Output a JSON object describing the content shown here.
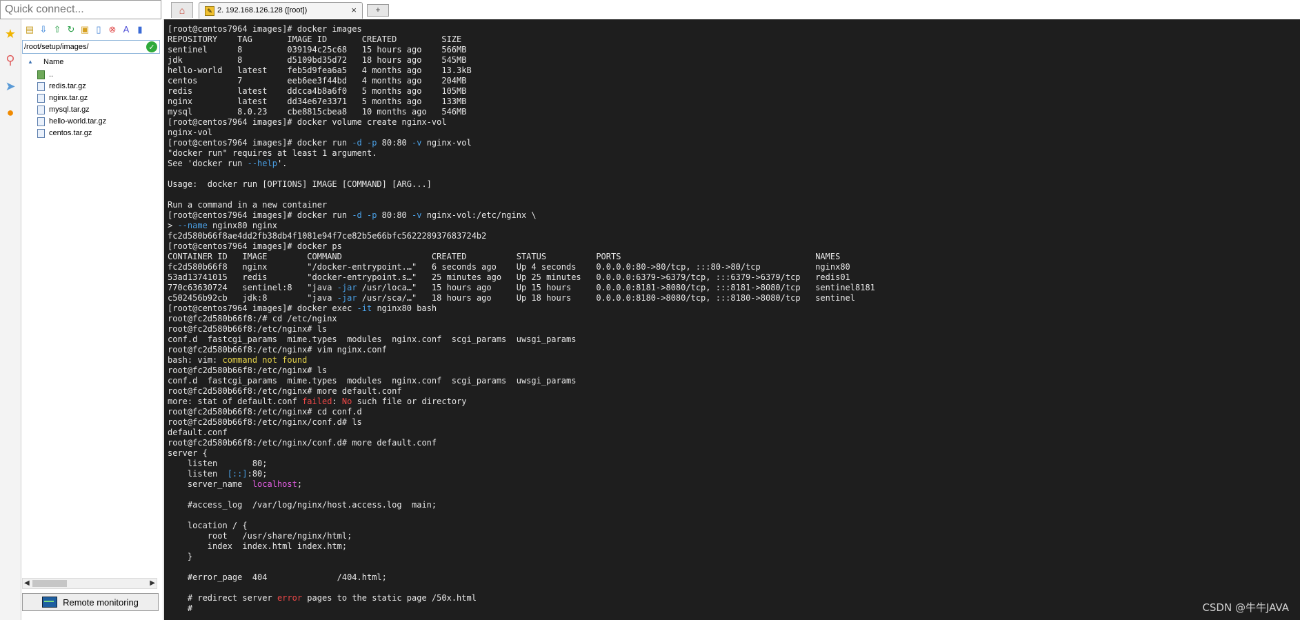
{
  "sidebar": {
    "quick_connect_placeholder": "Quick connect...",
    "rail_icons": [
      "star-icon",
      "session-icon",
      "send-icon",
      "tools-icon"
    ],
    "toolbar_icons": [
      "up-folder-icon",
      "download-icon",
      "upload-icon",
      "refresh-icon",
      "new-folder-icon",
      "new-file-icon",
      "delete-icon",
      "rename-icon",
      "properties-icon"
    ],
    "path": "/root/setup/images/",
    "tree_header": "Name",
    "files": [
      {
        "name": "..",
        "kind": "folder"
      },
      {
        "name": "redis.tar.gz",
        "kind": "file"
      },
      {
        "name": "nginx.tar.gz",
        "kind": "file"
      },
      {
        "name": "mysql.tar.gz",
        "kind": "file"
      },
      {
        "name": "hello-world.tar.gz",
        "kind": "file"
      },
      {
        "name": "centos.tar.gz",
        "kind": "file"
      }
    ],
    "remote_monitoring_label": "Remote monitoring"
  },
  "tabs": {
    "session_label": "2. 192.168.126.128 ([root])",
    "close_glyph": "×",
    "new_tab_glyph": "+"
  },
  "terminal": {
    "lines": [
      [
        [
          "[root@centos7964 images]# docker images",
          ""
        ]
      ],
      [
        [
          "REPOSITORY    TAG       IMAGE ID       CREATED         SIZE",
          ""
        ]
      ],
      [
        [
          "sentinel      8         039194c25c68   15 hours ago    566MB",
          ""
        ]
      ],
      [
        [
          "jdk           8         d5109bd35d72   18 hours ago    545MB",
          ""
        ]
      ],
      [
        [
          "hello-world   latest    feb5d9fea6a5   4 months ago    13.3kB",
          ""
        ]
      ],
      [
        [
          "centos        7         eeb6ee3f44bd   4 months ago    204MB",
          ""
        ]
      ],
      [
        [
          "redis         latest    ddcca4b8a6f0   5 months ago    105MB",
          ""
        ]
      ],
      [
        [
          "nginx         latest    dd34e67e3371   5 months ago    133MB",
          ""
        ]
      ],
      [
        [
          "mysql         8.0.23    cbe8815cbea8   10 months ago   546MB",
          ""
        ]
      ],
      [
        [
          "[root@centos7964 images]# docker volume create nginx-vol",
          ""
        ]
      ],
      [
        [
          "nginx-vol",
          ""
        ]
      ],
      [
        [
          "[root@centos7964 images]# docker run ",
          ""
        ],
        [
          "-d -p",
          "blue"
        ],
        [
          " 80:80 ",
          ""
        ],
        [
          "-v",
          "blue"
        ],
        [
          " nginx-vol",
          ""
        ]
      ],
      [
        [
          "\"docker run\" requires at least 1 argument.",
          ""
        ]
      ],
      [
        [
          "See 'docker run ",
          ""
        ],
        [
          "--help",
          "blue"
        ],
        [
          "'.",
          ""
        ]
      ],
      [
        [
          "",
          ""
        ]
      ],
      [
        [
          "Usage:  docker run [OPTIONS] IMAGE [COMMAND] [ARG...]",
          ""
        ]
      ],
      [
        [
          "",
          ""
        ]
      ],
      [
        [
          "Run a command in a new container",
          ""
        ]
      ],
      [
        [
          "[root@centos7964 images]# docker run ",
          ""
        ],
        [
          "-d -p",
          "blue"
        ],
        [
          " 80:80 ",
          ""
        ],
        [
          "-v",
          "blue"
        ],
        [
          " nginx-vol:/etc/nginx \\",
          ""
        ]
      ],
      [
        [
          "> ",
          ""
        ],
        [
          "--name",
          "blue"
        ],
        [
          " nginx80 nginx",
          ""
        ]
      ],
      [
        [
          "fc2d580b66f8ae4dd2fb38db4f1081e94f7ce82b5e66bfc562228937683724b2",
          ""
        ]
      ],
      [
        [
          "[root@centos7964 images]# docker ps",
          ""
        ]
      ],
      [
        [
          "CONTAINER ID   IMAGE        COMMAND                  CREATED          STATUS          PORTS                                       NAMES",
          ""
        ]
      ],
      [
        [
          "fc2d580b66f8   nginx        \"/docker-entrypoint.…\"   6 seconds ago    Up 4 seconds    0.0.0.0:80->80/tcp, :::80->80/tcp           nginx80",
          ""
        ]
      ],
      [
        [
          "53ad13741015   redis        \"docker-entrypoint.s…\"   25 minutes ago   Up 25 minutes   0.0.0.0:6379->6379/tcp, :::6379->6379/tcp   redis01",
          ""
        ]
      ],
      [
        [
          "770c63630724   sentinel:8   \"java ",
          ""
        ],
        [
          "-jar",
          "blue"
        ],
        [
          " /usr/loca…\"   15 hours ago     Up 15 hours     0.0.0.0:8181->8080/tcp, :::8181->8080/tcp   sentinel8181",
          ""
        ]
      ],
      [
        [
          "c502456b92cb   jdk:8        \"java ",
          ""
        ],
        [
          "-jar",
          "blue"
        ],
        [
          " /usr/sca/…\"   18 hours ago     Up 18 hours     0.0.0.0:8180->8080/tcp, :::8180->8080/tcp   sentinel",
          ""
        ]
      ],
      [
        [
          "[root@centos7964 images]# docker exec ",
          ""
        ],
        [
          "-it",
          "blue"
        ],
        [
          " nginx80 bash",
          ""
        ]
      ],
      [
        [
          "root@fc2d580b66f8:/# cd /etc/nginx",
          ""
        ]
      ],
      [
        [
          "root@fc2d580b66f8:/etc/nginx# ls",
          ""
        ]
      ],
      [
        [
          "conf.d  fastcgi_params  mime.types  modules  nginx.conf  scgi_params  uwsgi_params",
          ""
        ]
      ],
      [
        [
          "root@fc2d580b66f8:/etc/nginx# vim nginx.conf",
          ""
        ]
      ],
      [
        [
          "bash: vim: ",
          ""
        ],
        [
          "command not found",
          "yellow"
        ]
      ],
      [
        [
          "root@fc2d580b66f8:/etc/nginx# ls",
          ""
        ]
      ],
      [
        [
          "conf.d  fastcgi_params  mime.types  modules  nginx.conf  scgi_params  uwsgi_params",
          ""
        ]
      ],
      [
        [
          "root@fc2d580b66f8:/etc/nginx# more default.conf",
          ""
        ]
      ],
      [
        [
          "more: stat of default.conf ",
          ""
        ],
        [
          "failed",
          "red"
        ],
        [
          ": ",
          ""
        ],
        [
          "No",
          "red"
        ],
        [
          " such file or directory",
          ""
        ]
      ],
      [
        [
          "root@fc2d580b66f8:/etc/nginx# cd conf.d",
          ""
        ]
      ],
      [
        [
          "root@fc2d580b66f8:/etc/nginx/conf.d# ls",
          ""
        ]
      ],
      [
        [
          "default.conf",
          ""
        ]
      ],
      [
        [
          "root@fc2d580b66f8:/etc/nginx/conf.d# more default.conf",
          ""
        ]
      ],
      [
        [
          "server {",
          ""
        ]
      ],
      [
        [
          "    listen       80;",
          ""
        ]
      ],
      [
        [
          "    listen  ",
          ""
        ],
        [
          "[::]",
          "blue"
        ],
        [
          ":80;",
          ""
        ]
      ],
      [
        [
          "    server_name  ",
          ""
        ],
        [
          "localhost",
          "mag"
        ],
        [
          ";",
          ""
        ]
      ],
      [
        [
          "",
          ""
        ]
      ],
      [
        [
          "    #access_log  /var/log/nginx/host.access.log  main;",
          ""
        ]
      ],
      [
        [
          "",
          ""
        ]
      ],
      [
        [
          "    location / {",
          ""
        ]
      ],
      [
        [
          "        root   /usr/share/nginx/html;",
          ""
        ]
      ],
      [
        [
          "        index  index.html index.htm;",
          ""
        ]
      ],
      [
        [
          "    }",
          ""
        ]
      ],
      [
        [
          "",
          ""
        ]
      ],
      [
        [
          "    #error_page  404              /404.html;",
          ""
        ]
      ],
      [
        [
          "",
          ""
        ]
      ],
      [
        [
          "    # redirect server ",
          ""
        ],
        [
          "error",
          "red"
        ],
        [
          " pages to the static page /50x.html",
          ""
        ]
      ],
      [
        [
          "    #",
          ""
        ]
      ]
    ]
  },
  "watermark": "CSDN @牛牛JAVA"
}
